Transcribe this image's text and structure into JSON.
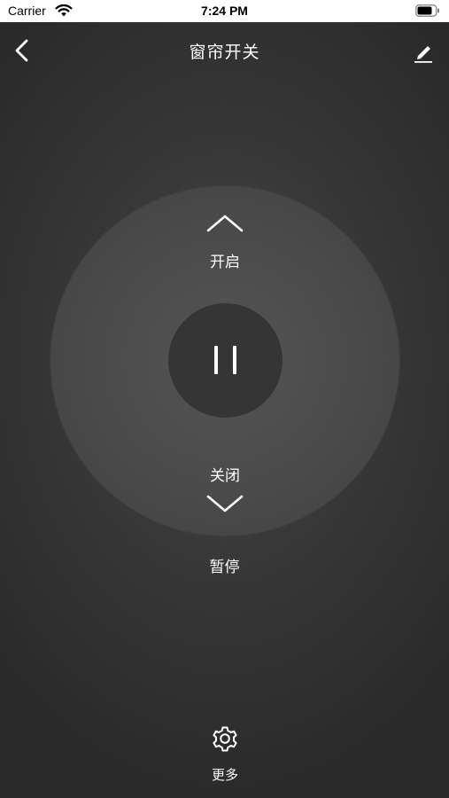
{
  "status_bar": {
    "carrier": "Carrier",
    "time": "7:24 PM",
    "wifi_icon": "wifi-icon",
    "battery_icon": "battery-icon"
  },
  "nav": {
    "title": "窗帘开关",
    "back_icon": "chevron-left-icon",
    "edit_icon": "pencil-icon"
  },
  "remote": {
    "open_label": "开启",
    "close_label": "关闭",
    "pause_label": "暂停",
    "pause_icon": "pause-icon"
  },
  "footer": {
    "more_label": "更多",
    "more_icon": "gear-icon"
  },
  "colors": {
    "background": "#2f2f2f",
    "dial": "#4a4a4a",
    "center_button": "#353535",
    "text": "#ffffff"
  }
}
